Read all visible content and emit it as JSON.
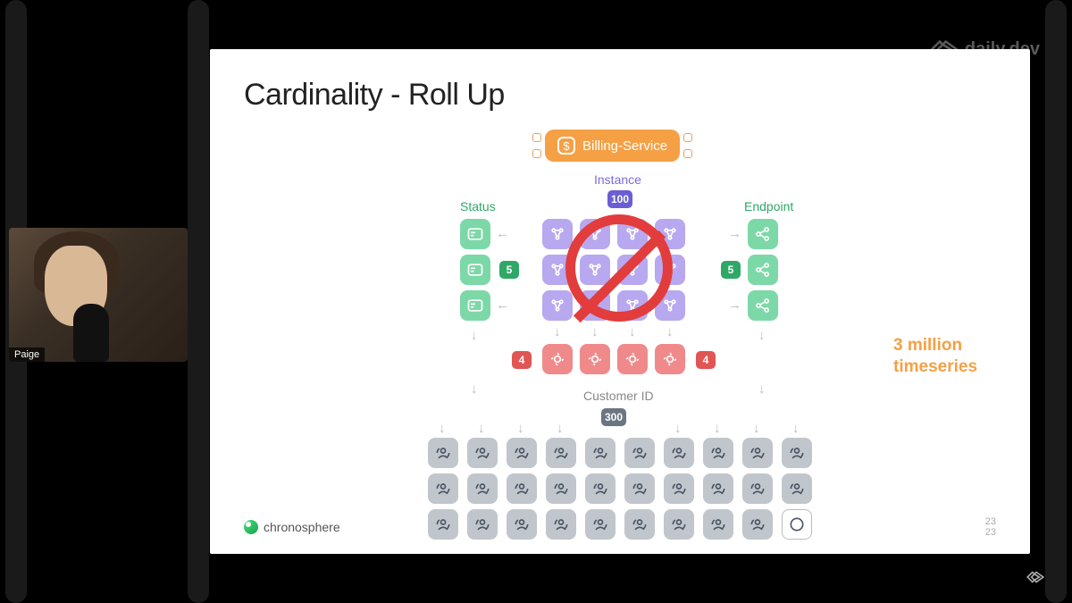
{
  "watermark": {
    "text": "daily.dev"
  },
  "presenter": {
    "name": "Paige"
  },
  "slide": {
    "title": "Cardinality - Roll Up",
    "footer_brand": "chronosphere",
    "page_a": "23",
    "page_b": "23",
    "service": {
      "label": "Billing-Service"
    },
    "labels": {
      "instance": "Instance",
      "status": "Status",
      "endpoint": "Endpoint",
      "customer": "Customer ID"
    },
    "counts": {
      "instance": "100",
      "status": "5",
      "endpoint": "5",
      "region_left": "4",
      "region_right": "4",
      "customer": "300"
    },
    "callout_line1": "3 million",
    "callout_line2": "timeseries"
  }
}
